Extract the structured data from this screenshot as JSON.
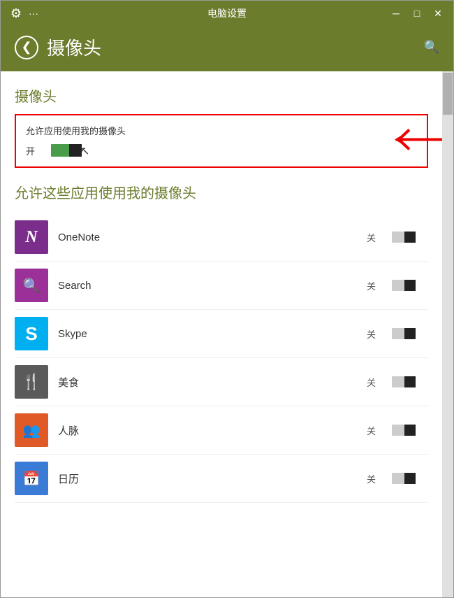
{
  "window": {
    "title": "电脑设置",
    "minimize_label": "─",
    "restore_label": "□",
    "close_label": "✕"
  },
  "header": {
    "back_label": "❮",
    "title": "摄像头",
    "search_icon": "🔍"
  },
  "main_section": {
    "title": "摄像头",
    "toggle_label": "允许应用使用我的摄像头",
    "toggle_state": "开"
  },
  "apps_section": {
    "title": "允许这些应用使用我的摄像头",
    "apps": [
      {
        "name": "OneNote",
        "status": "关",
        "icon_type": "onenote",
        "icon_char": "N"
      },
      {
        "name": "Search",
        "status": "关",
        "icon_type": "search",
        "icon_char": "🔍"
      },
      {
        "name": "Skype",
        "status": "关",
        "icon_type": "skype",
        "icon_char": "S"
      },
      {
        "name": "美食",
        "status": "关",
        "icon_type": "food",
        "icon_char": "🍴"
      },
      {
        "name": "人脉",
        "status": "关",
        "icon_type": "people",
        "icon_char": "👥"
      },
      {
        "name": "日历",
        "status": "关",
        "icon_type": "calendar",
        "icon_char": "📅"
      }
    ]
  }
}
